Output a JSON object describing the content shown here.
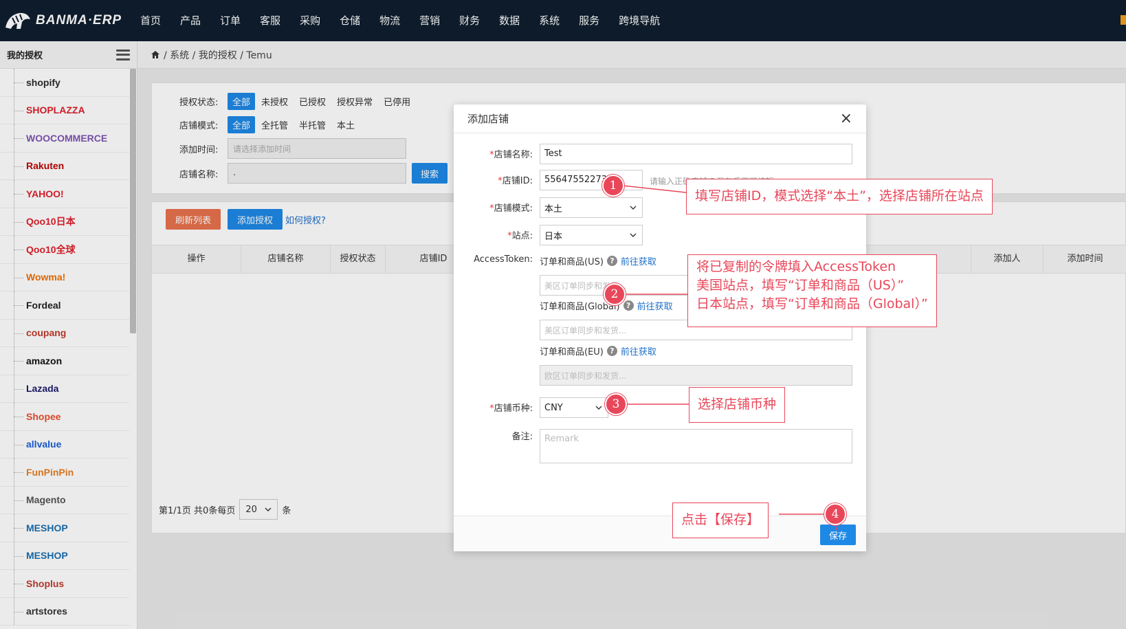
{
  "app": {
    "logo_text": "BANMA·ERP"
  },
  "nav": {
    "items": [
      "首页",
      "产品",
      "订单",
      "客服",
      "采购",
      "仓储",
      "物流",
      "营销",
      "财务",
      "数据",
      "系统",
      "服务",
      "跨境导航"
    ]
  },
  "sidebar": {
    "title": "我的授权",
    "items": [
      {
        "label": "shopify",
        "color": "#2a2a2a"
      },
      {
        "label": "SHOPLAZZA",
        "color": "#e0202c"
      },
      {
        "label": "WOOCOMMERCE",
        "color": "#7f54b3"
      },
      {
        "label": "Rakuten",
        "color": "#bf0000"
      },
      {
        "label": "YAHOO!",
        "color": "#e0202c"
      },
      {
        "label": "Qoo10日本",
        "color": "#e0202c"
      },
      {
        "label": "Qoo10全球",
        "color": "#e0202c"
      },
      {
        "label": "Wowma!",
        "color": "#f07000"
      },
      {
        "label": "Fordeal",
        "color": "#222222"
      },
      {
        "label": "coupang",
        "color": "#c0392b"
      },
      {
        "label": "amazon",
        "color": "#111111"
      },
      {
        "label": "Lazada",
        "color": "#1a1a6e"
      },
      {
        "label": "Shopee",
        "color": "#ee4d2d"
      },
      {
        "label": "allvalue",
        "color": "#1c5fd8"
      },
      {
        "label": "FunPinPin",
        "color": "#e67e22"
      },
      {
        "label": "Magento",
        "color": "#555555"
      },
      {
        "label": "MESHOP",
        "color": "#1a6fb0"
      },
      {
        "label": "MESHOP",
        "color": "#1a6fb0"
      },
      {
        "label": "Shoplus",
        "color": "#c0392b"
      },
      {
        "label": "artstores",
        "color": "#333333"
      }
    ]
  },
  "breadcrumb": {
    "path": "/ 系统 / 我的授权 / Temu"
  },
  "filters": {
    "status_label": "授权状态:",
    "status_options": [
      "全部",
      "未授权",
      "已授权",
      "授权异常",
      "已停用"
    ],
    "mode_label": "店铺模式:",
    "mode_options": [
      "全部",
      "全托管",
      "半托管",
      "本土"
    ],
    "time_label": "添加时间:",
    "time_placeholder": "请选择添加时间",
    "name_label": "店铺名称:",
    "name_value": ".",
    "search_button": "搜索"
  },
  "list": {
    "refresh_button": "刷新列表",
    "add_button": "添加授权",
    "how_link": "如何授权?",
    "columns": [
      "操作",
      "店铺名称",
      "授权状态",
      "店铺ID",
      "添加人",
      "添加时间"
    ],
    "pager": {
      "summary": "第1/1页 共0条每页",
      "page_size": "20",
      "unit": "条"
    }
  },
  "modal": {
    "title": "添加店铺",
    "shop_name_label": "店铺名称:",
    "shop_name_value": "Test",
    "shop_id_label": "店铺ID:",
    "shop_id_value": "55647552273",
    "shop_id_hint": "请输入正确店铺ID保存后不可编辑",
    "mode_label": "店铺模式:",
    "mode_value": "本土",
    "site_label": "站点:",
    "site_value": "日本",
    "token_label": "AccessToken:",
    "token_us_label": "订单和商品(US)",
    "token_us_placeholder": "美区订单同步和发货...",
    "token_global_label": "订单和商品(Global)",
    "token_global_placeholder": "美区订单同步和发货...",
    "token_eu_label": "订单和商品(EU)",
    "token_eu_placeholder": "欧区订单同步和发货...",
    "get_link": "前往获取",
    "currency_label": "店铺币种:",
    "currency_value": "CNY",
    "remark_label": "备注:",
    "remark_placeholder": "Remark",
    "save_button": "保存"
  },
  "annotations": [
    {
      "num": "1",
      "text": "填写店铺ID，模式选择“本土”，选择店铺所在站点"
    },
    {
      "num": "2",
      "lines": [
        "将已复制的令牌填入AccessToken",
        "美国站点，填写“订单和商品（US）”",
        "日本站点，填写“订单和商品（Global）”"
      ]
    },
    {
      "num": "3",
      "text": "选择店铺币种"
    },
    {
      "num": "4",
      "text": "点击【保存】"
    }
  ],
  "colors": {
    "accent": "#1e88e5",
    "annotation": "#e8475a",
    "nav_bg": "#0f1e2e",
    "refresh": "#e8714c"
  }
}
